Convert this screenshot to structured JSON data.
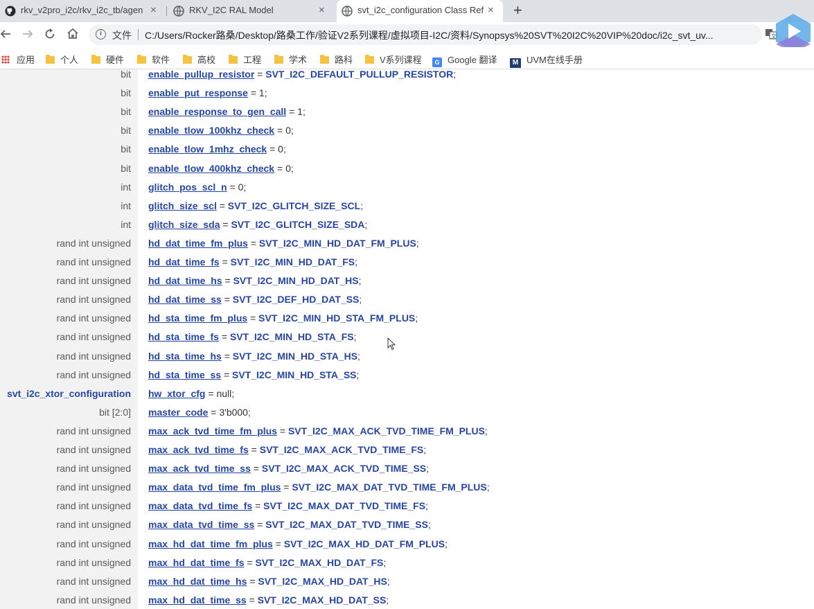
{
  "tabs": [
    {
      "title": "rkv_v2pro_i2c/rkv_i2c_tb/agen",
      "icon": "github-icon",
      "active": false
    },
    {
      "title": "RKV_I2C RAL Model",
      "icon": "globe-icon",
      "active": false
    },
    {
      "title": "svt_i2c_configuration Class Ref",
      "icon": "globe-icon",
      "active": true
    }
  ],
  "tab_close_glyph": "×",
  "new_tab_glyph": "+",
  "toolbar": {
    "scheme_label": "文件",
    "url": "C:/Users/Rocker路桑/Desktop/路桑工作/验证V2系列课程/虚拟项目-I2C/资料/Synopsys%20SVT%20I2C%20VIP%20doc/i2c_svt_uv..."
  },
  "bookmarks": [
    {
      "label": "应用",
      "icon": "apps-grid-icon"
    },
    {
      "label": "个人",
      "icon": "folder-icon"
    },
    {
      "label": "硬件",
      "icon": "folder-icon"
    },
    {
      "label": "软件",
      "icon": "folder-icon"
    },
    {
      "label": "高校",
      "icon": "folder-icon"
    },
    {
      "label": "工程",
      "icon": "folder-icon"
    },
    {
      "label": "学术",
      "icon": "folder-icon"
    },
    {
      "label": "路科",
      "icon": "folder-icon"
    },
    {
      "label": "V系列课程",
      "icon": "folder-icon"
    },
    {
      "label": "Google 翻译",
      "icon": "google-translate-icon"
    },
    {
      "label": "UVM在线手册",
      "icon": "uvm-logo-icon"
    }
  ],
  "members": [
    {
      "type": "bit",
      "name": "enable_pullup_resistor",
      "eq": " = ",
      "value": "SVT_I2C_DEFAULT_PULLUP_RESISTOR",
      "value_is_const": true
    },
    {
      "type": "bit",
      "name": "enable_put_response",
      "eq": " = ",
      "value": "1",
      "value_is_const": false
    },
    {
      "type": "bit",
      "name": "enable_response_to_gen_call",
      "eq": " = ",
      "value": "1",
      "value_is_const": false
    },
    {
      "type": "bit",
      "name": "enable_tlow_100khz_check",
      "eq": " = ",
      "value": "0",
      "value_is_const": false
    },
    {
      "type": "bit",
      "name": "enable_tlow_1mhz_check",
      "eq": " = ",
      "value": "0",
      "value_is_const": false
    },
    {
      "type": "bit",
      "name": "enable_tlow_400khz_check",
      "eq": " = ",
      "value": "0",
      "value_is_const": false
    },
    {
      "type": "int",
      "name": "glitch_pos_scl_n",
      "eq": " = ",
      "value": "0",
      "value_is_const": false
    },
    {
      "type": "int",
      "name": "glitch_size_scl",
      "eq": " = ",
      "value": "SVT_I2C_GLITCH_SIZE_SCL",
      "value_is_const": true
    },
    {
      "type": "int",
      "name": "glitch_size_sda",
      "eq": " = ",
      "value": "SVT_I2C_GLITCH_SIZE_SDA",
      "value_is_const": true
    },
    {
      "type": "rand int unsigned",
      "name": "hd_dat_time_fm_plus",
      "eq": " = ",
      "value": "SVT_I2C_MIN_HD_DAT_FM_PLUS",
      "value_is_const": true
    },
    {
      "type": "rand int unsigned",
      "name": "hd_dat_time_fs",
      "eq": " = ",
      "value": "SVT_I2C_MIN_HD_DAT_FS",
      "value_is_const": true
    },
    {
      "type": "rand int unsigned",
      "name": "hd_dat_time_hs",
      "eq": " = ",
      "value": "SVT_I2C_MIN_HD_DAT_HS",
      "value_is_const": true
    },
    {
      "type": "rand int unsigned",
      "name": "hd_dat_time_ss",
      "eq": " = ",
      "value": "SVT_I2C_DEF_HD_DAT_SS",
      "value_is_const": true
    },
    {
      "type": "rand int unsigned",
      "name": "hd_sta_time_fm_plus",
      "eq": " = ",
      "value": "SVT_I2C_MIN_HD_STA_FM_PLUS",
      "value_is_const": true
    },
    {
      "type": "rand int unsigned",
      "name": "hd_sta_time_fs",
      "eq": " = ",
      "value": "SVT_I2C_MIN_HD_STA_FS",
      "value_is_const": true
    },
    {
      "type": "rand int unsigned",
      "name": "hd_sta_time_hs",
      "eq": " = ",
      "value": "SVT_I2C_MIN_HD_STA_HS",
      "value_is_const": true
    },
    {
      "type": "rand int unsigned",
      "name": "hd_sta_time_ss",
      "eq": " = ",
      "value": "SVT_I2C_MIN_HD_STA_SS",
      "value_is_const": true
    },
    {
      "type": "svt_i2c_xtor_configuration",
      "type_is_link": true,
      "name": "hw_xtor_cfg",
      "eq": " = ",
      "value": "null",
      "value_is_const": false
    },
    {
      "type": "bit [2:0]",
      "name": "master_code",
      "eq": " = ",
      "value": "3'b000",
      "value_is_const": false
    },
    {
      "type": "rand int unsigned",
      "name": "max_ack_tvd_time_fm_plus",
      "eq": " = ",
      "value": "SVT_I2C_MAX_ACK_TVD_TIME_FM_PLUS",
      "value_is_const": true
    },
    {
      "type": "rand int unsigned",
      "name": "max_ack_tvd_time_fs",
      "eq": " = ",
      "value": "SVT_I2C_MAX_ACK_TVD_TIME_FS",
      "value_is_const": true
    },
    {
      "type": "rand int unsigned",
      "name": "max_ack_tvd_time_ss",
      "eq": " = ",
      "value": "SVT_I2C_MAX_ACK_TVD_TIME_SS",
      "value_is_const": true
    },
    {
      "type": "rand int unsigned",
      "name": "max_data_tvd_time_fm_plus",
      "eq": " = ",
      "value": "SVT_I2C_MAX_DAT_TVD_TIME_FM_PLUS",
      "value_is_const": true
    },
    {
      "type": "rand int unsigned",
      "name": "max_data_tvd_time_fs",
      "eq": " = ",
      "value": "SVT_I2C_MAX_DAT_TVD_TIME_FS",
      "value_is_const": true
    },
    {
      "type": "rand int unsigned",
      "name": "max_data_tvd_time_ss",
      "eq": " = ",
      "value": "SVT_I2C_MAX_DAT_TVD_TIME_SS",
      "value_is_const": true
    },
    {
      "type": "rand int unsigned",
      "name": "max_hd_dat_time_fm_plus",
      "eq": " = ",
      "value": "SVT_I2C_MAX_HD_DAT_FM_PLUS",
      "value_is_const": true
    },
    {
      "type": "rand int unsigned",
      "name": "max_hd_dat_time_fs",
      "eq": " = ",
      "value": "SVT_I2C_MAX_HD_DAT_FS",
      "value_is_const": true
    },
    {
      "type": "rand int unsigned",
      "name": "max_hd_dat_time_hs",
      "eq": " = ",
      "value": "SVT_I2C_MAX_HD_DAT_HS",
      "value_is_const": true
    },
    {
      "type": "rand int unsigned",
      "name": "max_hd_dat_time_ss",
      "eq": " = ",
      "value": "SVT_I2C_MAX_HD_DAT_SS",
      "value_is_const": true
    }
  ],
  "colors": {
    "link_blue": "#2646a6",
    "type_gray": "#595959",
    "type_col_bg": "#f2f2f2",
    "tabstrip_bg": "#dee1e6"
  }
}
